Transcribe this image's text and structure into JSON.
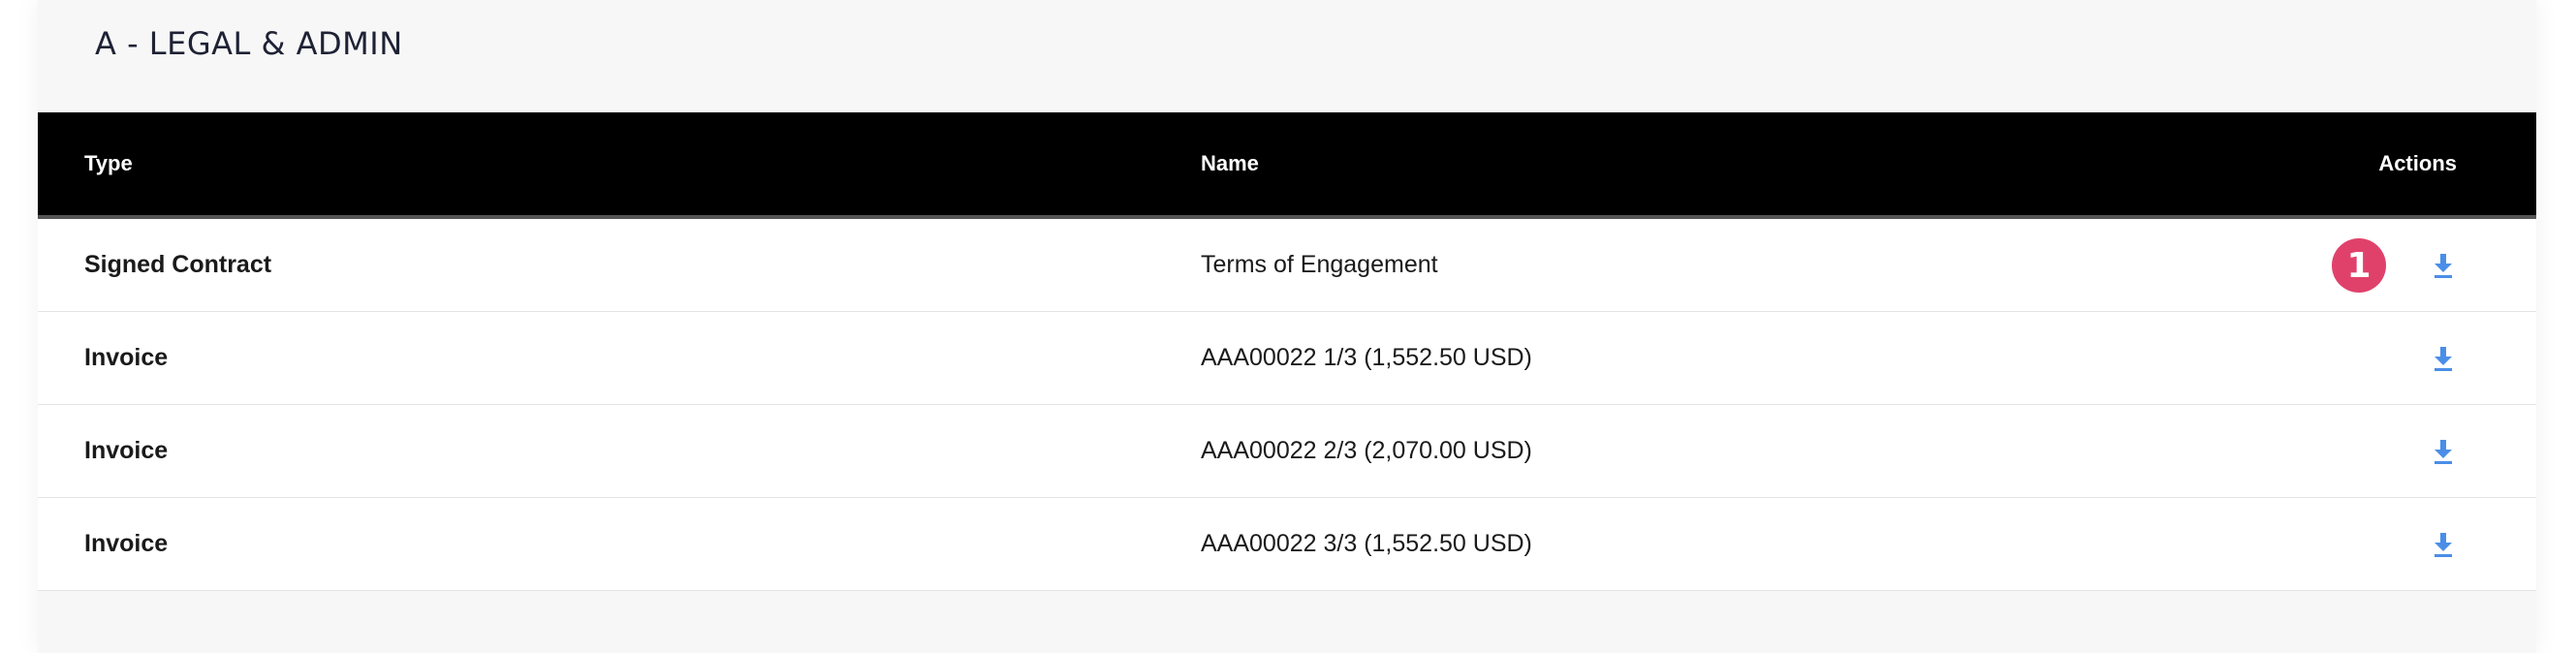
{
  "section": {
    "title": "A - LEGAL & ADMIN"
  },
  "table": {
    "headers": {
      "type": "Type",
      "name": "Name",
      "actions": "Actions"
    },
    "rows": [
      {
        "type": "Signed Contract",
        "name": "Terms of Engagement",
        "action_icon": "download-icon"
      },
      {
        "type": "Invoice",
        "name": "AAA00022 1/3 (1,552.50 USD)",
        "action_icon": "download-icon"
      },
      {
        "type": "Invoice",
        "name": "AAA00022 2/3 (2,070.00 USD)",
        "action_icon": "download-icon"
      },
      {
        "type": "Invoice",
        "name": "AAA00022 3/3 (1,552.50 USD)",
        "action_icon": "download-icon"
      }
    ]
  },
  "annotation": {
    "badge_label": "1"
  },
  "colors": {
    "header_bg": "#000000",
    "accent_icon": "#4a8ee8",
    "badge": "#e0416a"
  }
}
